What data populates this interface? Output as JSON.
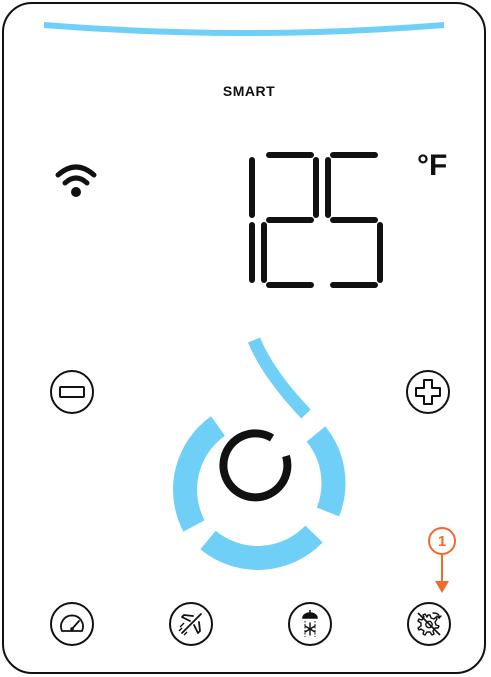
{
  "display": {
    "mode_label": "SMART",
    "temperature": "125",
    "unit": "°F"
  },
  "controls": {
    "decrease": {
      "icon": "minus-icon"
    },
    "increase": {
      "icon": "plus-icon"
    },
    "bottom": [
      {
        "name": "performance-button",
        "icon": "speedometer-icon"
      },
      {
        "name": "vacation-button",
        "icon": "airplane-icon"
      },
      {
        "name": "shower-button",
        "icon": "shower-snowflake-icon"
      },
      {
        "name": "settings-reset-button",
        "icon": "gear-return-icon"
      }
    ]
  },
  "annotation": {
    "number": "1",
    "color": "#ef6a2f"
  },
  "colors": {
    "accent": "#6fcff6",
    "stroke": "#111111"
  },
  "status": {
    "wifi_icon": "wifi-icon",
    "flame_indicator": "flame-ring-icon"
  }
}
